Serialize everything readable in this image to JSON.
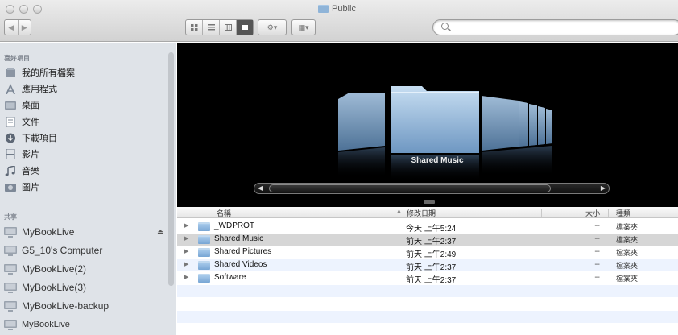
{
  "window": {
    "title": "Public"
  },
  "toolbar": {
    "nav_back": "◀",
    "nav_forward": "▶",
    "action_label": "⚙▾",
    "arrange_label": "▦▾",
    "search_placeholder": "",
    "search_value": ""
  },
  "sidebar": {
    "favorites_heading": "喜好項目",
    "favorites": [
      {
        "label": "我的所有檔案",
        "icon": "all-files-icon"
      },
      {
        "label": "應用程式",
        "icon": "applications-icon"
      },
      {
        "label": "桌面",
        "icon": "desktop-icon"
      },
      {
        "label": "文件",
        "icon": "documents-icon"
      },
      {
        "label": "下載項目",
        "icon": "downloads-icon"
      },
      {
        "label": "影片",
        "icon": "movies-icon"
      },
      {
        "label": "音樂",
        "icon": "music-icon"
      },
      {
        "label": "圖片",
        "icon": "pictures-icon"
      }
    ],
    "shared_heading": "共享",
    "shared": [
      {
        "label": "MyBookLive",
        "icon": "network-display-icon"
      },
      {
        "label": "G5_10's Computer",
        "icon": "network-display-icon"
      },
      {
        "label": "MyBookLive(2)",
        "icon": "network-display-icon"
      },
      {
        "label": "MyBookLive(3)",
        "icon": "network-display-icon"
      },
      {
        "label": "MyBookLive-backup",
        "icon": "network-display-icon"
      },
      {
        "label": "MyBookLive",
        "icon": "network-display-icon"
      }
    ],
    "eject_glyph": "⏏"
  },
  "coverflow": {
    "current_label": "Shared Music",
    "left_arrow": "◀",
    "right_arrow": "▶"
  },
  "list": {
    "columns": {
      "name": "名稱",
      "date": "修改日期",
      "size": "大小",
      "kind": "種類"
    },
    "rows": [
      {
        "name": "_WDPROT",
        "date": "今天 上午5:24",
        "size": "--",
        "kind": "檔案夾"
      },
      {
        "name": "Shared Music",
        "date": "前天 上午2:37",
        "size": "--",
        "kind": "檔案夾",
        "selected": true
      },
      {
        "name": "Shared Pictures",
        "date": "前天 上午2:49",
        "size": "--",
        "kind": "檔案夾"
      },
      {
        "name": "Shared Videos",
        "date": "前天 上午2:37",
        "size": "--",
        "kind": "檔案夾"
      },
      {
        "name": "Software",
        "date": "前天 上午2:37",
        "size": "--",
        "kind": "檔案夾"
      }
    ]
  },
  "colors": {
    "sidebar_bg": "#dfe3e8",
    "row_alt": "#edf3fe",
    "row_selected": "#d6d6d6",
    "folder_blue": "#8fb4d8"
  }
}
